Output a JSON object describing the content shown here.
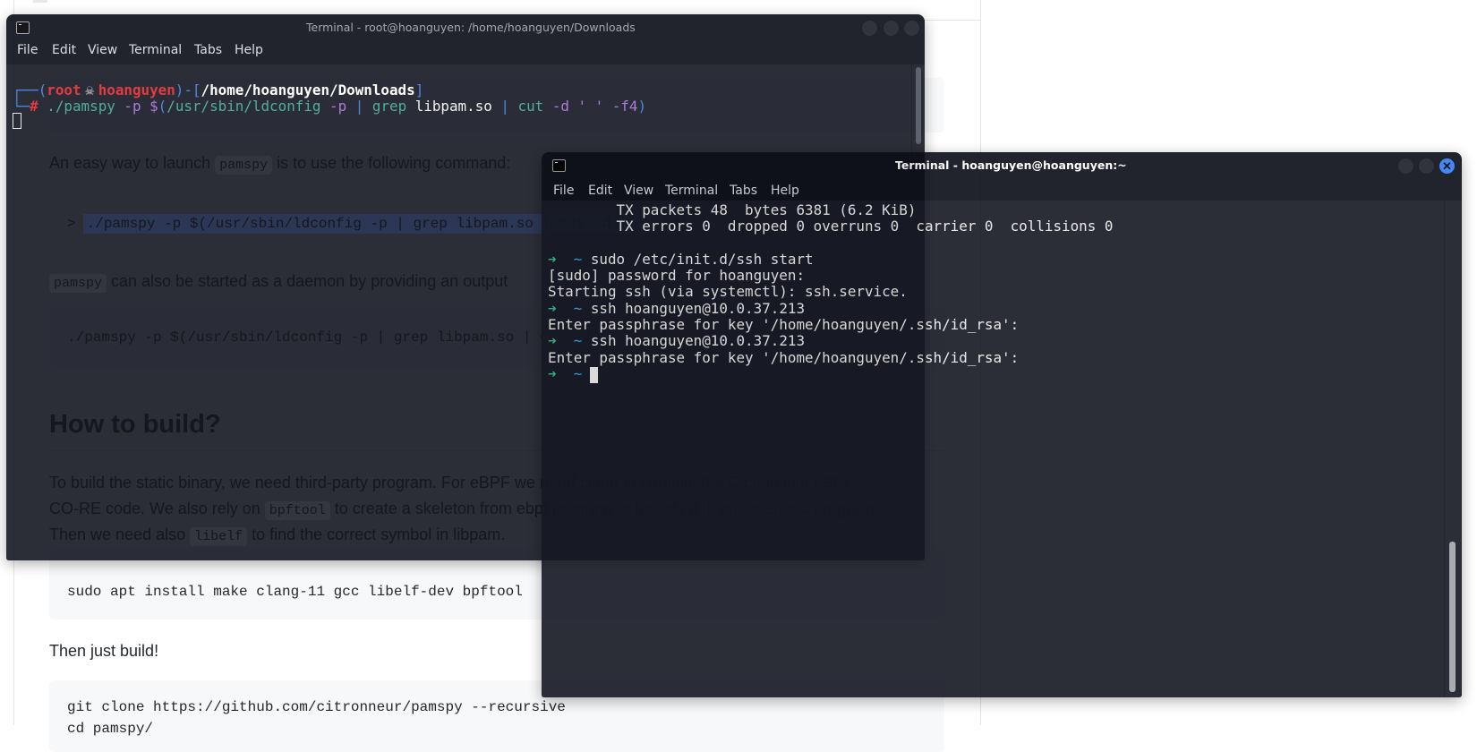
{
  "page": {
    "para_launch": {
      "pre": "An easy way to launch ",
      "code": "pamspy",
      "post": " is to use the following command:"
    },
    "quote": {
      "marker": ">",
      "code": "./pamspy -p $(/usr/sbin/ldconfig -p | grep libpam.so | cut -d ' ' -f4)"
    },
    "para_daemon": {
      "code": "pamspy",
      "post": " can also be started as a daemon by providing an output"
    },
    "daemon_code": "./pamspy -p $(/usr/sbin/ldconfig -p | grep libpam.so | cut -d ' ' -f4)",
    "heading_build": "How to build?",
    "para_build": {
      "line1": "To build the static binary, we need third-party program. For eBPF we need clang to compile the C code into eBPF",
      "line2_pre": "CO-RE code. We also rely on ",
      "line2_code": "bpftool",
      "line2_post": " to create a skeleton from ebpf program to include it in our userland program.",
      "line3_pre": "Then we need also ",
      "line3_code": "libelf",
      "line3_post": " to find the correct symbol in libpam."
    },
    "install_code": "sudo apt install make clang-11 gcc libelf-dev bpftool",
    "para_then": "Then just build!",
    "build_code": [
      "git clone https://github.com/citronneur/pamspy --recursive",
      "cd pamspy/"
    ]
  },
  "terminal_root": {
    "title": "Terminal - root@hoanguyen: /home/hoanguyen/Downloads",
    "menu": [
      "File",
      "Edit",
      "View",
      "Terminal",
      "Tabs",
      "Help"
    ],
    "scroll_position": 0.0,
    "lines": [
      [
        {
          "t": "┌──(",
          "c": "blue"
        },
        {
          "t": "root",
          "c": "red"
        },
        {
          "t": "☠",
          "c": "skull"
        },
        {
          "t": "hoanguyen",
          "c": "red"
        },
        {
          "t": ")-[",
          "c": "blue"
        },
        {
          "t": "/home/hoanguyen/Downloads",
          "c": "white-bold"
        },
        {
          "t": "]",
          "c": "blue"
        }
      ],
      [
        {
          "t": "└─",
          "c": "blue"
        },
        {
          "t": "#",
          "c": "red"
        },
        {
          "t": " ./pamspy",
          "c": "teal"
        },
        {
          "t": " -p",
          "c": "purple"
        },
        {
          "t": " $",
          "c": "purple"
        },
        {
          "t": "(",
          "c": "blue"
        },
        {
          "t": "/usr/sbin/ldconfig",
          "c": "teal"
        },
        {
          "t": " -p",
          "c": "purple"
        },
        {
          "t": " |",
          "c": "blue"
        },
        {
          "t": " grep",
          "c": "teal"
        },
        {
          "t": " libpam.so",
          "c": "white"
        },
        {
          "t": " |",
          "c": "blue"
        },
        {
          "t": " cut",
          "c": "teal"
        },
        {
          "t": " -d ' ' -f4",
          "c": "purple"
        },
        {
          "t": ")",
          "c": "blue"
        }
      ]
    ]
  },
  "terminal_user": {
    "title": "Terminal - hoanguyen@hoanguyen:~",
    "menu": [
      "File",
      "Edit",
      "View",
      "Terminal",
      "Tabs",
      "Help"
    ],
    "scroll_position": 1.0,
    "lines": [
      [
        {
          "t": "        TX packets 48  bytes 6381 (6.2 KiB)",
          "c": "plain"
        }
      ],
      [
        {
          "t": "        TX errors 0  dropped 0 overruns 0  carrier 0  collisions 0",
          "c": "plain"
        }
      ],
      [],
      [
        {
          "t": "➜",
          "c": "arrow"
        },
        {
          "t": "  ",
          "c": "plain"
        },
        {
          "t": "~",
          "c": "cyan"
        },
        {
          "t": " sudo /etc/init.d/ssh start",
          "c": "plain"
        }
      ],
      [
        {
          "t": "[sudo] password for hoanguyen:",
          "c": "plain"
        }
      ],
      [
        {
          "t": "Starting ssh (via systemctl): ssh.service.",
          "c": "plain"
        }
      ],
      [
        {
          "t": "➜",
          "c": "arrow"
        },
        {
          "t": "  ",
          "c": "plain"
        },
        {
          "t": "~",
          "c": "cyan"
        },
        {
          "t": " ssh hoanguyen@10.0.37.213",
          "c": "plain"
        }
      ],
      [
        {
          "t": "Enter passphrase for key '/home/hoanguyen/.ssh/id_rsa':",
          "c": "plain"
        }
      ],
      [
        {
          "t": "➜",
          "c": "arrow"
        },
        {
          "t": "  ",
          "c": "plain"
        },
        {
          "t": "~",
          "c": "cyan"
        },
        {
          "t": " ssh hoanguyen@10.0.37.213",
          "c": "plain"
        }
      ],
      [
        {
          "t": "Enter passphrase for key '/home/hoanguyen/.ssh/id_rsa':",
          "c": "plain"
        }
      ],
      [
        {
          "t": "➜",
          "c": "arrow"
        },
        {
          "t": "  ",
          "c": "plain"
        },
        {
          "t": "~",
          "c": "cyan"
        },
        {
          "t": " ",
          "c": "plain"
        }
      ]
    ]
  },
  "icons": {
    "window": "terminal-icon",
    "close": "close-icon"
  },
  "colors": {
    "accent": "#2f7cf6",
    "prompt_arrow": "#2fbf8c",
    "prompt_tilde": "#3aa8e0",
    "root_user": "#e0282e"
  }
}
